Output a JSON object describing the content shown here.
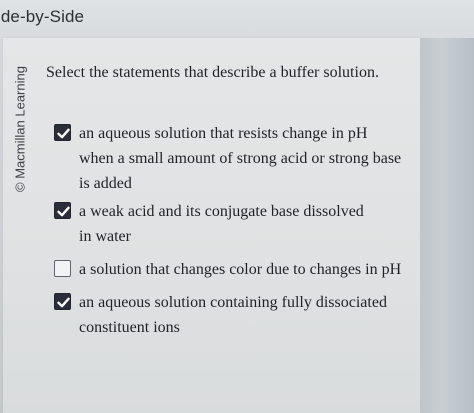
{
  "header": {
    "title": "ide-by-Side"
  },
  "sidebar": {
    "copyright": "© Macmillan Learning"
  },
  "question": {
    "prompt": "Select the statements that describe a buffer solution."
  },
  "options": [
    {
      "lines": [
        "an aqueous solution that resists change in pH",
        "when a small amount of strong acid or strong base",
        "is added"
      ],
      "checked": true
    },
    {
      "lines": [
        "a weak acid and its conjugate base dissolved",
        "in water"
      ],
      "checked": true
    },
    {
      "lines": [
        "a solution that changes color due to changes in pH"
      ],
      "checked": false
    },
    {
      "lines": [
        "an aqueous solution containing fully dissociated",
        "constituent ions"
      ],
      "checked": true
    }
  ],
  "colors": {
    "checkbox_checked": "#2a2d3a",
    "checkbox_unchecked_border": "#5f656b",
    "text": "#1f2226"
  },
  "icons": {
    "check": "checkmark-icon"
  }
}
